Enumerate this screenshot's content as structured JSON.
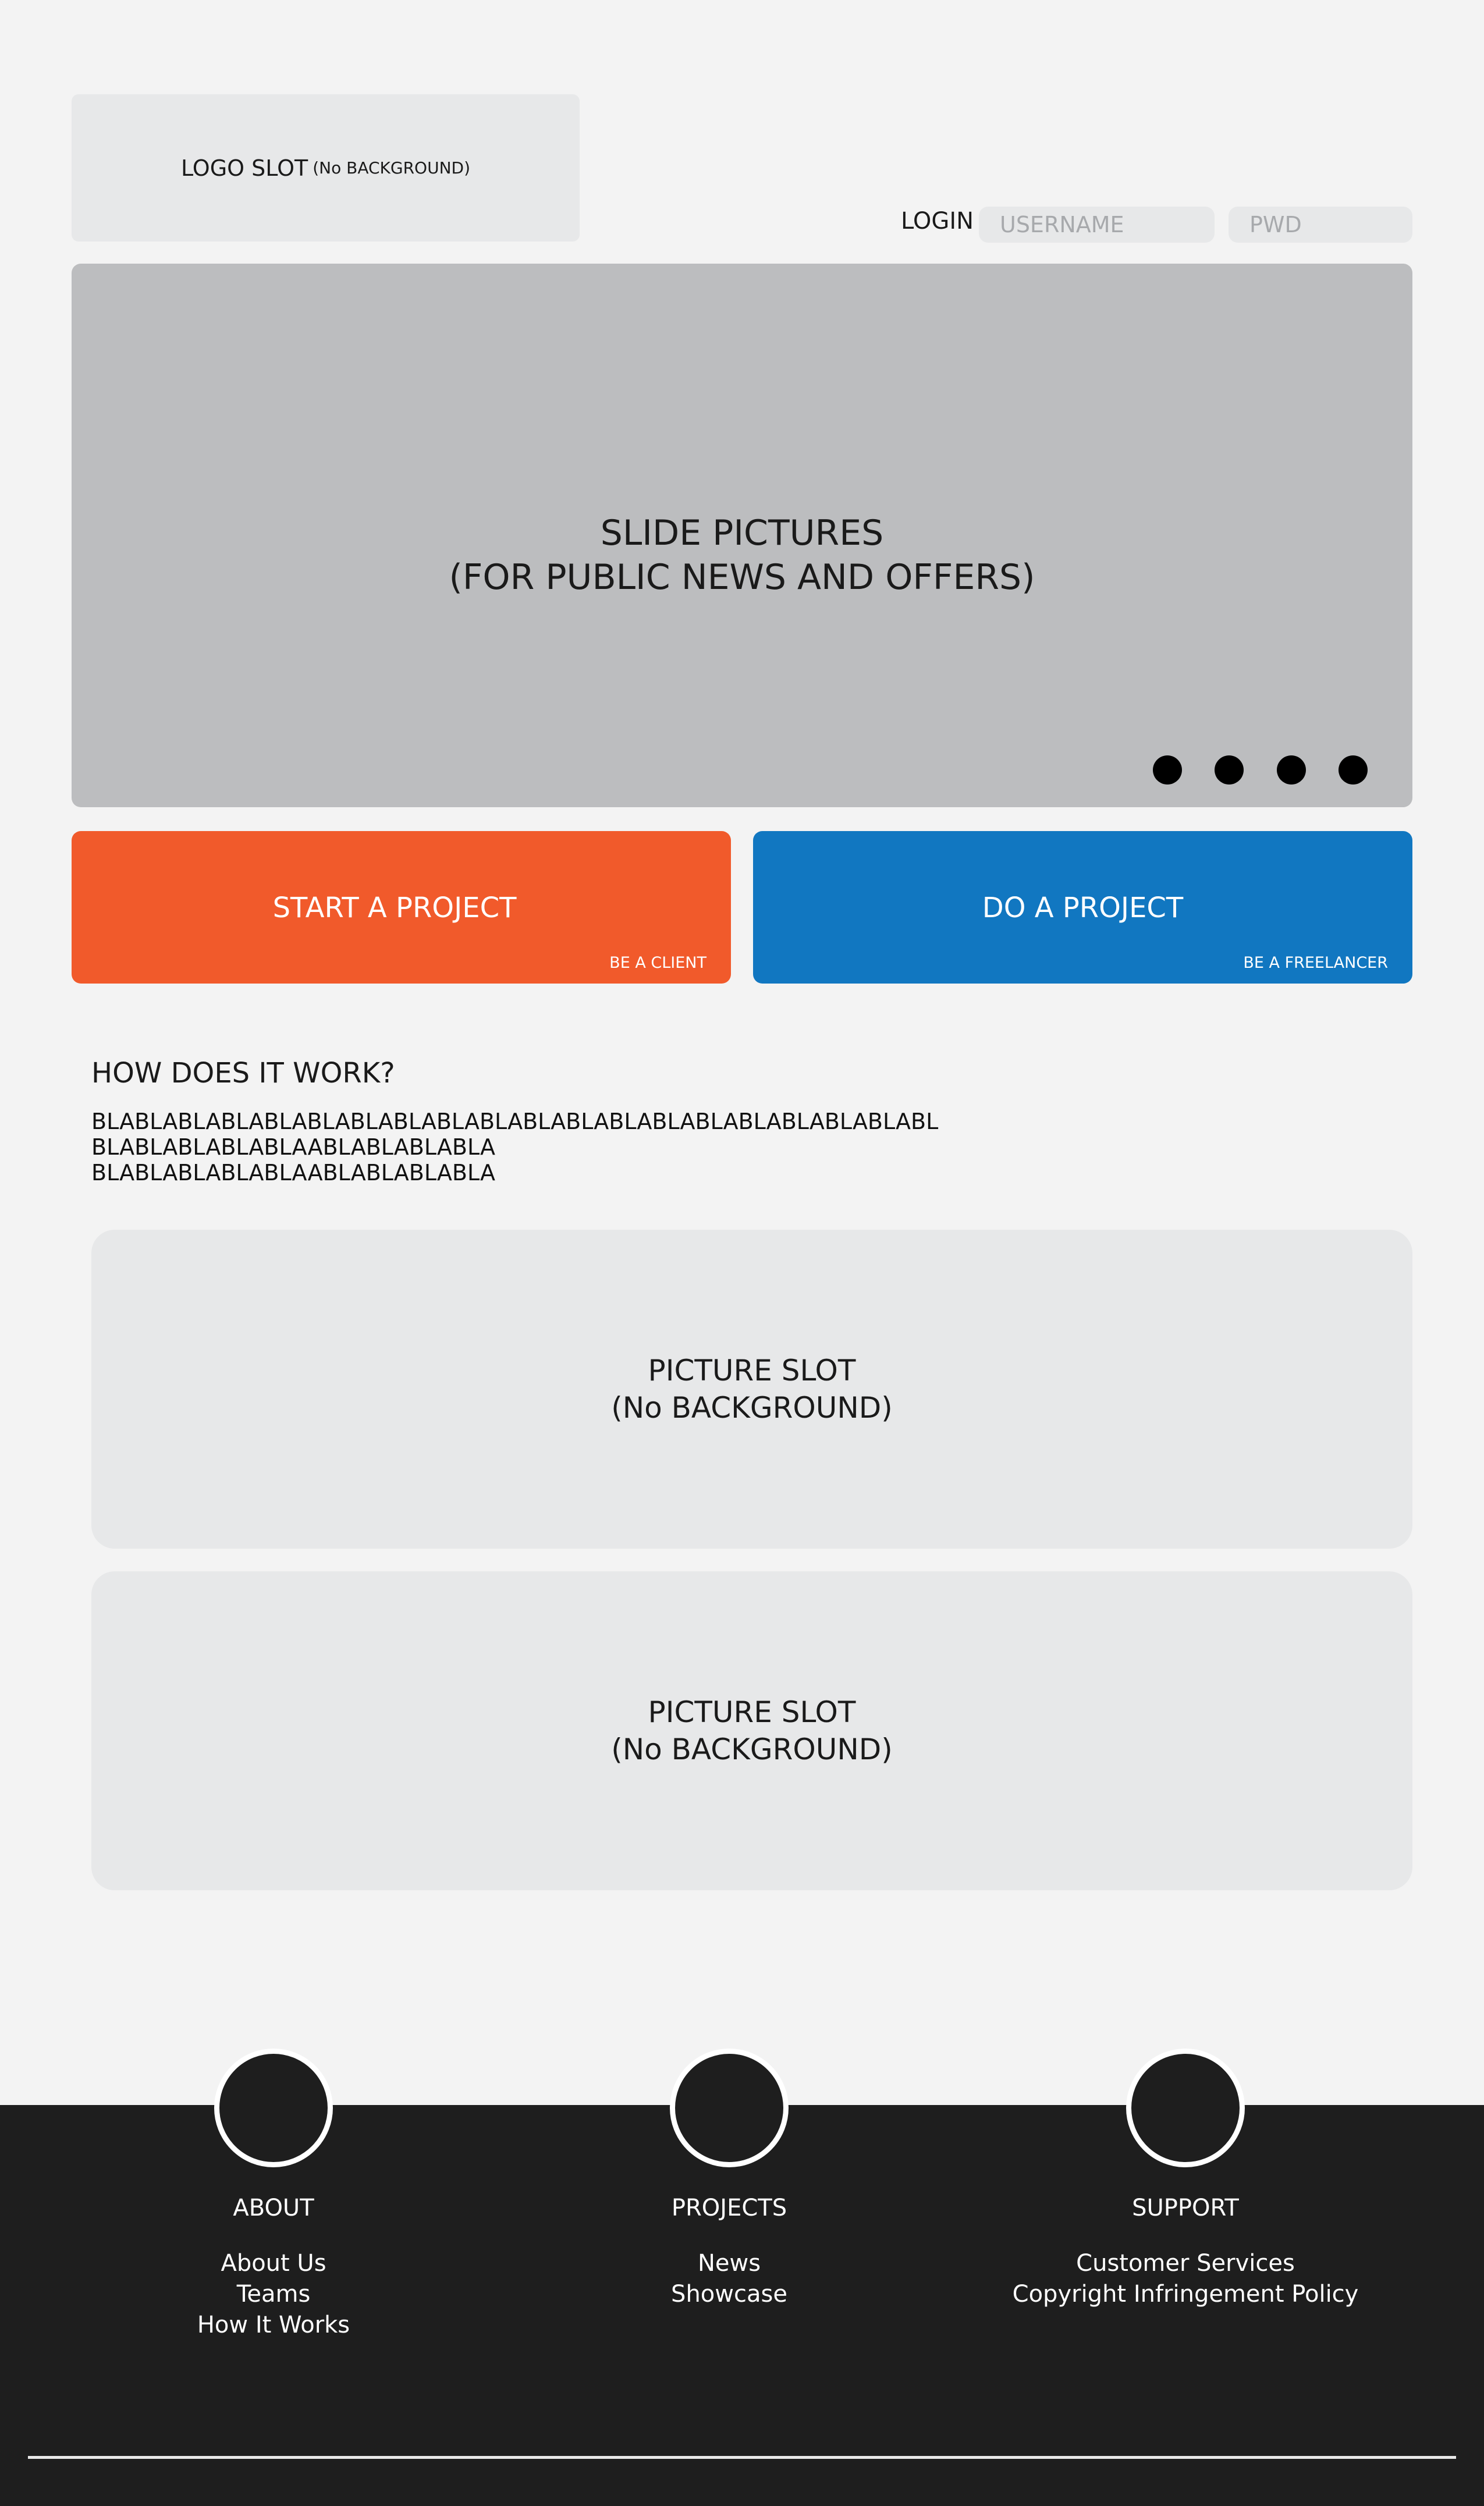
{
  "header": {
    "logo_label": "LOGO SLOT",
    "logo_note": "(No BACKGROUND)",
    "login_label": "LOGIN",
    "username_placeholder": "USERNAME",
    "password_placeholder": "PWD"
  },
  "slider": {
    "title_line1": "SLIDE PICTURES",
    "title_line2": "(FOR PUBLIC NEWS AND OFFERS)",
    "dot_count": 4
  },
  "cta": {
    "start": {
      "label": "START A PROJECT",
      "sublabel": "BE A CLIENT",
      "color": "#f15a2b"
    },
    "do": {
      "label": "DO A PROJECT",
      "sublabel": "BE A FREELANCER",
      "color": "#1177c1"
    }
  },
  "how": {
    "title": "HOW DOES IT WORK?",
    "lines": [
      "BLABLABLABLABLABLABLABLABLABLABLABLABLABLABLABLABLABLABLABL",
      "BLABLABLABLABLAABLABLABLABLA",
      "BLABLABLABLABLAABLABLABLABLA"
    ]
  },
  "picture_slots": [
    {
      "line1": "PICTURE SLOT",
      "line2": "(No BACKGROUND)"
    },
    {
      "line1": "PICTURE SLOT",
      "line2": "(No BACKGROUND)"
    }
  ],
  "footer": {
    "columns": [
      {
        "title": "ABOUT",
        "links": [
          "About Us",
          "Teams",
          "How It Works"
        ]
      },
      {
        "title": "PROJECTS",
        "links": [
          "News",
          "Showcase"
        ]
      },
      {
        "title": "SUPPORT",
        "links": [
          "Customer Services",
          "Copyright Infringement Policy"
        ]
      }
    ]
  }
}
